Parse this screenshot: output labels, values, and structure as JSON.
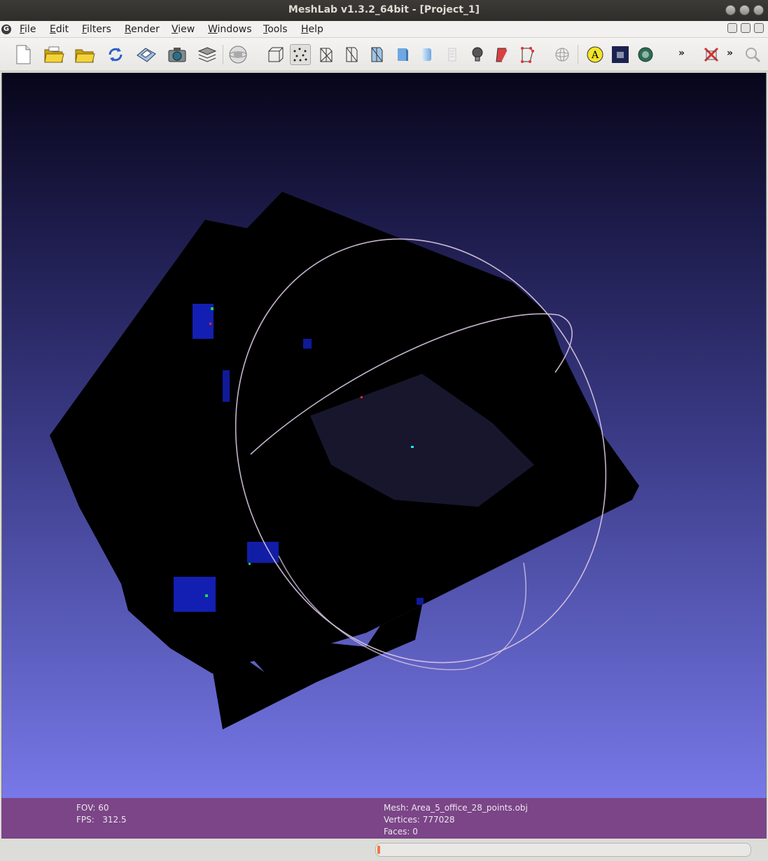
{
  "window": {
    "title": "MeshLab v1.3.2_64bit - [Project_1]"
  },
  "menu": {
    "items": [
      "File",
      "Edit",
      "Filters",
      "Render",
      "View",
      "Windows",
      "Tools",
      "Help"
    ]
  },
  "toolbar": {
    "buttons": [
      "new-project-icon",
      "open-project-icon",
      "import-mesh-icon",
      "reload-icon",
      "save-snapshot-icon",
      "camera-icon",
      "layers-icon",
      "ambient-occlusion-icon",
      "bounding-box-icon",
      "points-render-icon",
      "wireframe-icon",
      "hidden-lines-icon",
      "flat-lines-icon",
      "flat-shading-icon",
      "smooth-shading-icon",
      "texture-icon",
      "lighting-icon",
      "backface-icon",
      "color-icon",
      "trackball-icon",
      "annotation-icon",
      "shader-icon",
      "decorations-icon",
      "more-icon",
      "delete-icon",
      "more-icon-2",
      "search-icon"
    ],
    "active": "points-render-icon"
  },
  "viewport": {
    "background_top": "#07061a",
    "background_bottom": "#7878e8",
    "trackball_color": "#d9c8e4"
  },
  "info": {
    "fov": "FOV: 60",
    "fps": "FPS:   312.5",
    "mesh": "Mesh: Area_5_office_28_points.obj",
    "vertices": "Vertices: 777028",
    "faces": "Faces: 0"
  },
  "status": {
    "progress": 0.01,
    "progress_color": "#f07746"
  }
}
